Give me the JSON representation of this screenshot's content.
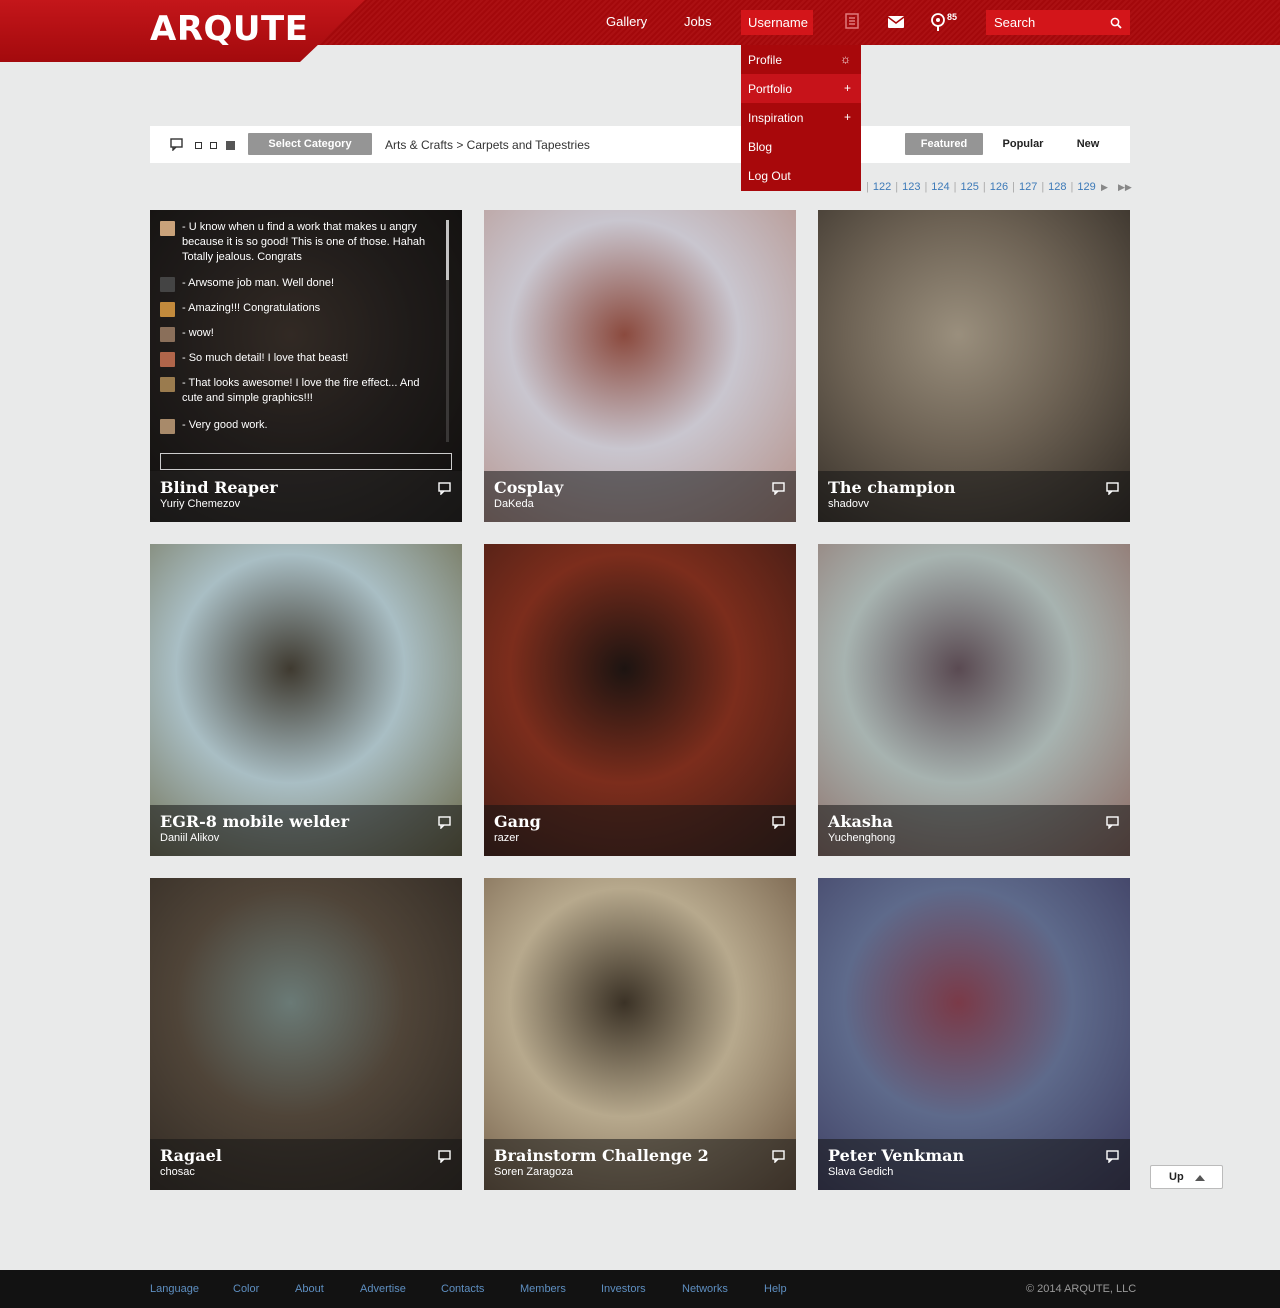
{
  "header": {
    "logo": "ARQUTE",
    "nav": {
      "gallery": "Gallery",
      "jobs": "Jobs",
      "username": "Username"
    },
    "notification_count": "85",
    "search_placeholder": "Search"
  },
  "dropdown": {
    "items": [
      {
        "label": "Profile",
        "icon": "gear-icon"
      },
      {
        "label": "Portfolio",
        "icon": "plus-icon"
      },
      {
        "label": "Inspiration",
        "icon": "plus-icon"
      },
      {
        "label": "Blog"
      },
      {
        "label": "Log Out"
      }
    ]
  },
  "filter": {
    "select_category": "Select Category",
    "breadcrumb": "Arts & Crafts > Carpets and Tapestries",
    "sort": {
      "featured": "Featured",
      "popular": "Popular",
      "new": "New"
    }
  },
  "pagination": {
    "pages": [
      "122",
      "123",
      "124",
      "125",
      "126",
      "127",
      "128",
      "129"
    ]
  },
  "comments": [
    {
      "text": "- U know when u find a work that makes u angry because it is so good! This is one of those. Hahah Totally jealous. Congrats"
    },
    {
      "text": "- Arwsome job man. Well done!"
    },
    {
      "text": "- Amazing!!! Congratulations"
    },
    {
      "text": "- wow!"
    },
    {
      "text": "- So much detail! I love that beast!"
    },
    {
      "text": "- That looks awesome! I love the fire effect... And cute and simple graphics!!!"
    },
    {
      "text": "- Very good work."
    }
  ],
  "gallery": [
    {
      "title": "Blind Reaper",
      "author": "Yuriy Chemezov",
      "colors": [
        "#3a3330",
        "#1c1a18",
        "#5b4c42"
      ]
    },
    {
      "title": "Cosplay",
      "author": "DaKeda",
      "colors": [
        "#c9c6cf",
        "#b49088",
        "#8b4a3e"
      ]
    },
    {
      "title": "The champion",
      "author": "shadovv",
      "colors": [
        "#6d6254",
        "#2e2822",
        "#9a8f7d"
      ]
    },
    {
      "title": "EGR-8 mobile welder",
      "author": "Daniil Alikov",
      "colors": [
        "#a9bec4",
        "#6b6848",
        "#3f3a30"
      ]
    },
    {
      "title": "Gang",
      "author": "razer",
      "colors": [
        "#7c2d1c",
        "#3b1a14",
        "#1d1411"
      ]
    },
    {
      "title": "Akasha",
      "author": "Yuchenghong",
      "colors": [
        "#a7b3b0",
        "#8c6a63",
        "#5a4a52"
      ]
    },
    {
      "title": "Ragael",
      "author": "chosac",
      "colors": [
        "#4f4438",
        "#2d2620",
        "#6a7a76"
      ]
    },
    {
      "title": "Brainstorm Challenge 2",
      "author": "Soren Zaragoza",
      "colors": [
        "#b7a98d",
        "#6b5540",
        "#3b3226"
      ]
    },
    {
      "title": "Peter Venkman",
      "author": "Slava Gedich",
      "colors": [
        "#5e6a8b",
        "#3b3a5e",
        "#7a3a48"
      ]
    }
  ],
  "up_button": "Up",
  "footer": {
    "links": [
      "Language",
      "Color",
      "About",
      "Advertise",
      "Contacts",
      "Members",
      "Investors",
      "Networks",
      "Help"
    ],
    "copyright": "© 2014 ARQUTE, LLC"
  }
}
